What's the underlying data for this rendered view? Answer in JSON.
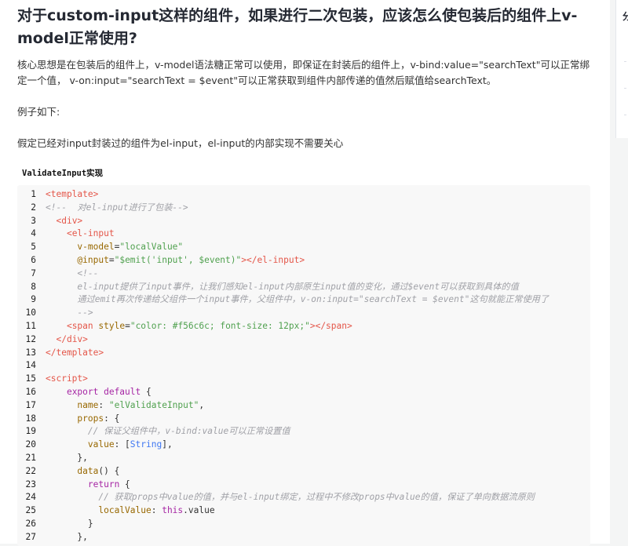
{
  "article": {
    "title": "对于custom-input这样的组件，如果进行二次包装，应该怎么使包装后的组件上v-model正常使用?",
    "paragraphs": [
      "核心思想是在包装后的组件上，v-model语法糖正常可以使用，即保证在封装后的组件上，v-bind:value=\"searchText\"可以正常绑定一个值， v-on:input=\"searchText = $event\"可以正常获取到组件内部传递的值然后赋值给searchText。",
      "例子如下:",
      "假定已经对input封装过的组件为el-input，el-input的内部实现不需要关心"
    ],
    "subheading": "ValidateInput实现"
  },
  "code": {
    "lines": [
      {
        "n": "1",
        "segs": [
          [
            "tag",
            "<template>"
          ]
        ]
      },
      {
        "n": "2",
        "segs": [
          [
            "cm",
            "<!--  对el-input进行了包装-->"
          ]
        ]
      },
      {
        "n": "3",
        "segs": [
          [
            "ct",
            "  "
          ],
          [
            "tag",
            "<div>"
          ]
        ]
      },
      {
        "n": "4",
        "segs": [
          [
            "ct",
            "    "
          ],
          [
            "tag",
            "<el-input"
          ]
        ]
      },
      {
        "n": "5",
        "segs": [
          [
            "ct",
            "      "
          ],
          [
            "attr",
            "v-model"
          ],
          [
            "ct",
            "="
          ],
          [
            "str",
            "\"localValue\""
          ]
        ]
      },
      {
        "n": "6",
        "segs": [
          [
            "ct",
            "      "
          ],
          [
            "attr",
            "@input"
          ],
          [
            "ct",
            "="
          ],
          [
            "str",
            "\"$emit('input', $event)\""
          ],
          [
            "tag",
            "></el-input>"
          ]
        ]
      },
      {
        "n": "7",
        "segs": [
          [
            "cm",
            "      <!--"
          ]
        ]
      },
      {
        "n": "8",
        "segs": [
          [
            "cm",
            "      el-input提供了input事件，让我们感知el-input内部原生input值的变化，通过$event可以获取到具体的值"
          ]
        ]
      },
      {
        "n": "9",
        "segs": [
          [
            "cm",
            "      通过emit再次传递给父组件一个input事件，父组件中，v-on:input=\"searchText = $event\"这句就能正常使用了"
          ]
        ]
      },
      {
        "n": "10",
        "segs": [
          [
            "cm",
            "      -->"
          ]
        ]
      },
      {
        "n": "11",
        "segs": [
          [
            "ct",
            "    "
          ],
          [
            "tag",
            "<span"
          ],
          [
            "ct",
            " "
          ],
          [
            "attr",
            "style"
          ],
          [
            "ct",
            "="
          ],
          [
            "str",
            "\"color: #f56c6c; font-size: 12px;\""
          ],
          [
            "tag",
            "></span>"
          ]
        ]
      },
      {
        "n": "12",
        "segs": [
          [
            "ct",
            "  "
          ],
          [
            "tag",
            "</div>"
          ]
        ]
      },
      {
        "n": "13",
        "segs": [
          [
            "tag",
            "</template>"
          ]
        ]
      },
      {
        "n": "14",
        "segs": []
      },
      {
        "n": "15",
        "segs": [
          [
            "tag",
            "<script>"
          ]
        ]
      },
      {
        "n": "16",
        "segs": [
          [
            "ct",
            "    "
          ],
          [
            "kw",
            "export default"
          ],
          [
            "ct",
            " {"
          ]
        ]
      },
      {
        "n": "17",
        "segs": [
          [
            "ct",
            "      "
          ],
          [
            "prop",
            "name"
          ],
          [
            "ct",
            ": "
          ],
          [
            "str",
            "\"elValidateInput\""
          ],
          [
            "ct",
            ","
          ]
        ]
      },
      {
        "n": "18",
        "segs": [
          [
            "ct",
            "      "
          ],
          [
            "prop",
            "props"
          ],
          [
            "ct",
            ": {"
          ]
        ]
      },
      {
        "n": "19",
        "segs": [
          [
            "cm",
            "        // 保证父组件中，v-bind:value可以正常设置值"
          ]
        ]
      },
      {
        "n": "20",
        "segs": [
          [
            "ct",
            "        "
          ],
          [
            "prop",
            "value"
          ],
          [
            "ct",
            ": ["
          ],
          [
            "num",
            "String"
          ],
          [
            "ct",
            "],"
          ]
        ]
      },
      {
        "n": "21",
        "segs": [
          [
            "ct",
            "      },"
          ]
        ]
      },
      {
        "n": "22",
        "segs": [
          [
            "ct",
            "      "
          ],
          [
            "prop",
            "data"
          ],
          [
            "ct",
            "() {"
          ]
        ]
      },
      {
        "n": "23",
        "segs": [
          [
            "ct",
            "        "
          ],
          [
            "kw",
            "return"
          ],
          [
            "ct",
            " {"
          ]
        ]
      },
      {
        "n": "24",
        "segs": [
          [
            "cm",
            "          // 获取props中value的值，并与el-input绑定，过程中不修改props中value的值，保证了单向数据流原则"
          ]
        ]
      },
      {
        "n": "25",
        "segs": [
          [
            "ct",
            "          "
          ],
          [
            "prop",
            "localValue"
          ],
          [
            "ct",
            ": "
          ],
          [
            "kw",
            "this"
          ],
          [
            "ct",
            ".value"
          ]
        ]
      },
      {
        "n": "26",
        "segs": [
          [
            "ct",
            "        }"
          ]
        ]
      },
      {
        "n": "27",
        "segs": [
          [
            "ct",
            "      },"
          ]
        ]
      }
    ]
  },
  "right_panel": {
    "glyph": "分"
  }
}
